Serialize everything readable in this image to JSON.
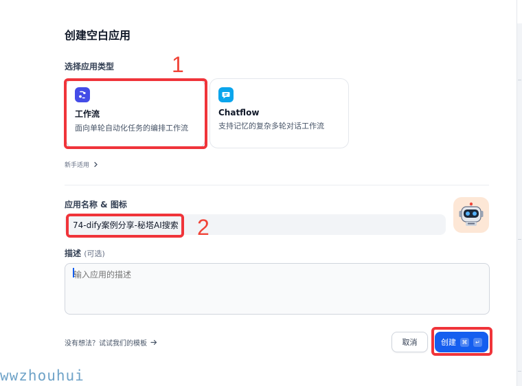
{
  "dialog": {
    "title": "创建空白应用",
    "type_section_label": "选择应用类型",
    "app_types": [
      {
        "title": "工作流",
        "description": "面向单轮自动化任务的编排工作流",
        "icon": "workflow-icon",
        "color": "#444ce7",
        "selected": true
      },
      {
        "title": "Chatflow",
        "description": "支持记忆的复杂多轮对话工作流",
        "icon": "chat-bubble-icon",
        "color": "#0ba5ec",
        "selected": false
      }
    ],
    "beginner_link": "新手适用",
    "name_section_label": "应用名称 & 图标",
    "name_value": "74-dify案例分享-秘塔AI搜索",
    "avatar_icon": "robot-icon",
    "desc_label": "描述",
    "desc_optional": "(可选)",
    "desc_placeholder": "输入应用的描述",
    "template_link": "没有想法？试试我们的模板",
    "cancel_label": "取消",
    "create_label": "创建",
    "shortcut_cmd": "⌘",
    "shortcut_enter": "↵"
  },
  "annotations": {
    "marker_1": "1",
    "marker_2": "2",
    "highlight_color": "#f0343a"
  },
  "watermark": "wwzhouhui"
}
